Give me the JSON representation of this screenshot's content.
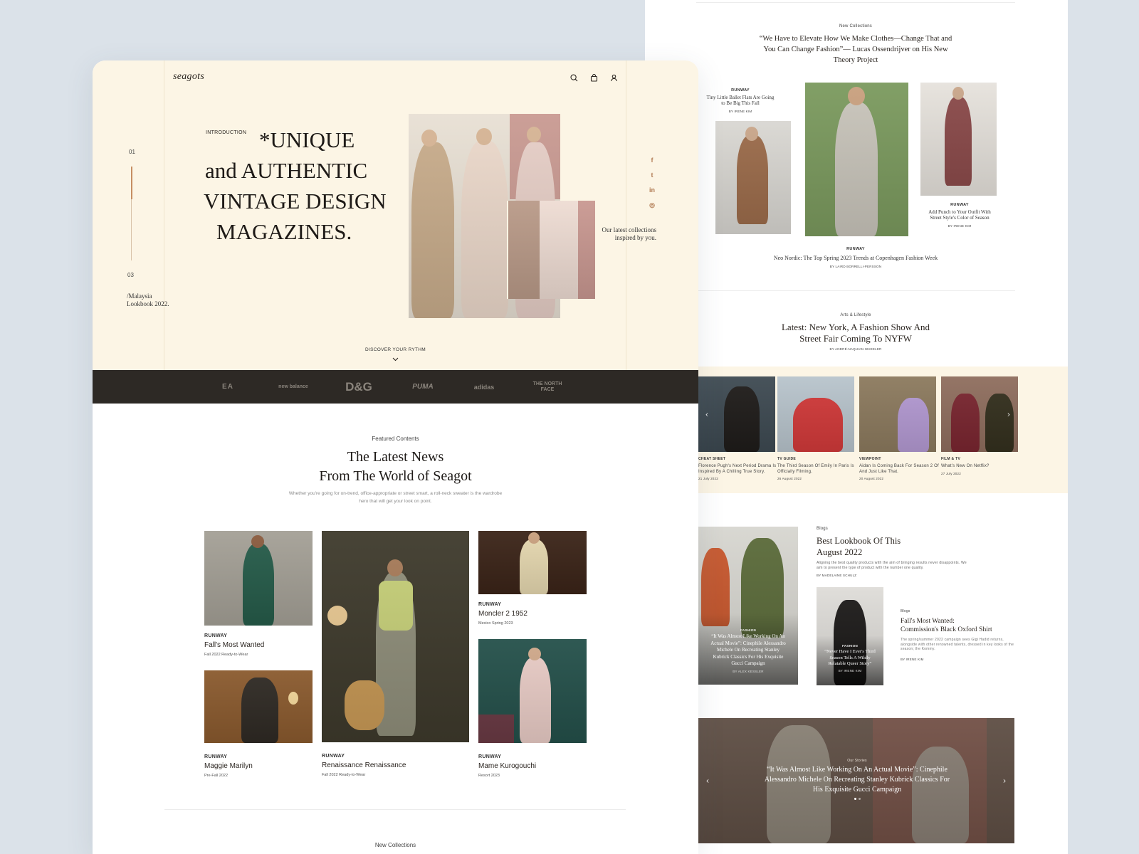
{
  "left": {
    "logo": "seagots",
    "hero": {
      "step_top": "01",
      "step_bottom": "03",
      "lookbook_line1": "/Malaysia",
      "lookbook_line2": "Lookbook 2022.",
      "intro_label": "INTRODUCTION",
      "headline": [
        "*UNIQUE",
        "and AUTHENTIC",
        "VINTAGE DESIGN",
        "MAGAZINES."
      ],
      "side_caption_line1": "Our latest collections",
      "side_caption_line2": "inspired by you.",
      "discover": "DISCOVER YOUR RYTHM",
      "icons": [
        "search-icon",
        "bag-icon",
        "user-icon"
      ],
      "socials": [
        {
          "name": "facebook-icon",
          "glyph": "f"
        },
        {
          "name": "twitter-icon",
          "glyph": "t"
        },
        {
          "name": "linkedin-icon",
          "glyph": "in"
        },
        {
          "name": "instagram-icon",
          "glyph": "◎"
        }
      ]
    },
    "brands": [
      "EA",
      "new balance",
      "D&G",
      "PUMA",
      "adidas",
      "THE NORTH FACE"
    ],
    "featured": {
      "label": "Featured Contents",
      "title_line1": "The Latest News",
      "title_line2": "From The World of Seagot",
      "desc_line1": "Whether you're going for on-trend, office-appropriate or street smart, a roll-neck sweater is the wardrobe",
      "desc_line2": "hero that will get your look on point.",
      "cards": [
        {
          "category": "RUNWAY",
          "title": "Fall's Most Wanted",
          "sub": "Fall 2022 Ready-to-Wear"
        },
        {
          "category": "RUNWAY",
          "title": "Maggie Marilyn",
          "sub": "Pre-Fall 2022"
        },
        {
          "category": "RUNWAY",
          "title": "Renaissance Renaissance",
          "sub": "Fall 2022 Ready-to-Wear"
        },
        {
          "category": "RUNWAY",
          "title": "Moncler 2 1952",
          "sub": "Mexico Spring 2023"
        },
        {
          "category": "RUNWAY",
          "title": "Mame Kurogouchi",
          "sub": "Resort 2023"
        }
      ]
    },
    "new_collections_label": "New Collections"
  },
  "right": {
    "collections": {
      "label": "New Collections",
      "quote_line1": "“We Have to Elevate How We Make Clothes—Change That and",
      "quote_line2": "You Can Change Fashion”— Lucas Ossendrijver on His New",
      "quote_line3": "Theory Project",
      "left_card": {
        "category": "RUNWAY",
        "title_line1": "Tiny Little Ballet Flats Are Going",
        "title_line2": "to Be Big This Fall",
        "author": "BY IRENE KIM"
      },
      "center_card": {
        "category": "RUNWAY",
        "title": "Neo Nordic: The Top Spring 2023 Trends at Copenhagen Fashion Week",
        "author": "BY LAIRD BORRELLI-PERSSON"
      },
      "right_card": {
        "category": "RUNWAY",
        "title_line1": "Add Punch to Your Outfit With",
        "title_line2": "Street Style's Color of Season",
        "author": "BY IRENE KIM"
      }
    },
    "arts": {
      "label": "Arts & Lifestyle",
      "title_line1": "Latest: New York, A Fashion Show And",
      "title_line2": "Street Fair Coming To NYFW",
      "author": "BY ANDRÉ-NAQUIAN WHEELER"
    },
    "carousel": [
      {
        "category": "CHEAT SHEET",
        "title_line1": "Florence Pugh's Next Period Drama Is",
        "title_line2": "Inspired By A Chilling True Story.",
        "date": "21 July 2022"
      },
      {
        "category": "TV GUIDE",
        "title_line1": "The Third Season Of Emily In Paris Is",
        "title_line2": "Officially Filming.",
        "date": "26 August 2022"
      },
      {
        "category": "VIEWPOINT",
        "title_line1": "Aidan Is Coming Back For Season 2 Of",
        "title_line2": "And Just Like That.",
        "date": "20 August 2022"
      },
      {
        "category": "FILM & TV",
        "title_line1": "What's New On Netflix?",
        "title_line2": "",
        "date": "27 July 2022"
      }
    ],
    "blogs": {
      "label": "Blogs",
      "title_line1": "Best Lookbook Of This",
      "title_line2": "August 2022",
      "desc_line1": "Aligning the best quality products with the aim of bringing results never disappoints. We",
      "desc_line2": "aim to present the type of product with the number one quality.",
      "author": "BY MADELAINE SCHULZ",
      "big_card": {
        "category": "FASHION",
        "title_lines": [
          "“It Was Almost Like Working On An",
          "Actual Movie”: Cinephile Alessandro",
          "Michele On Recreating Stanley",
          "Kubrick Classics For His Exquisite",
          "Gucci Campaign"
        ],
        "author": "BY ALEX KESSLER"
      },
      "small_card": {
        "category": "FASHION",
        "title_lines": [
          "“Never Have I Ever's Third",
          "Season Tells A Wildly",
          "Relatable Queer Story”"
        ],
        "author": "BY IRENE KIM"
      },
      "side": {
        "label": "Blogs",
        "title_line1": "Fall's Most Wanted:",
        "title_line2": "Commission's Black Oxford Shirt",
        "desc_line1": "The spring/summer 2022 campaign sees Gigi Hadid returns,",
        "desc_line2": "alongside with other renowned talents, dressed in key looks of the",
        "desc_line3": "season; the Kommy.",
        "author": "BY IRENE KIM"
      }
    },
    "stories": {
      "label": "Our Stories",
      "title_line1": "“It Was Almost Like Working On An Actual Movie”: Cinephile",
      "title_line2": "Alessandro Michele On Recreating Stanley Kubrick Classics For",
      "title_line3": "His Exquisite Gucci Campaign"
    }
  },
  "colors": {
    "cream": "#fcf5e5",
    "dark": "#2d2925",
    "accent": "#b07a52",
    "bg": "#dbe2e9"
  }
}
